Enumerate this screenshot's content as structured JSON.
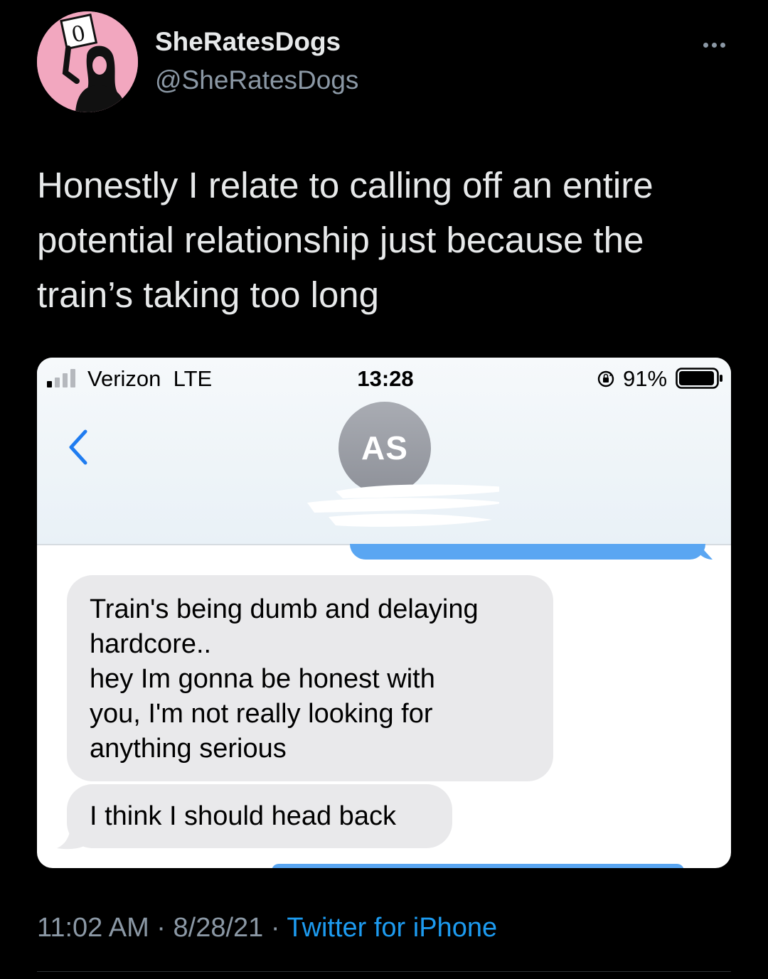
{
  "tweet": {
    "display_name": "SheRatesDogs",
    "handle": "@SheRatesDogs",
    "text": "Honestly I relate to calling off an entire potential relationship just because the train’s taking too long",
    "time": "11:02 AM",
    "date": "8/28/21",
    "separator": "·",
    "source": "Twitter for iPhone",
    "avatar_sign_text": "0",
    "colors": {
      "background": "#000000",
      "primary_text": "#e7e9ea",
      "secondary_text": "#8b98a5",
      "link": "#1d9bf0",
      "avatar_bg": "#f2a7bf"
    }
  },
  "phone": {
    "status_bar": {
      "carrier": "Verizon",
      "network": "LTE",
      "time": "13:28",
      "battery_percent": "91%"
    },
    "contact_initials": "AS",
    "messages": [
      {
        "direction": "received",
        "lines": [
          "Train's being dumb and delaying",
          "hardcore..",
          "hey Im gonna be honest with",
          "you, I'm not really looking for",
          "anything serious"
        ]
      },
      {
        "direction": "received",
        "text": "I think I should head back"
      }
    ],
    "colors": {
      "received_bubble": "#e9e9eb",
      "sent_bubble": "#5aa6f2",
      "back_chevron": "#1f7cf0"
    }
  }
}
